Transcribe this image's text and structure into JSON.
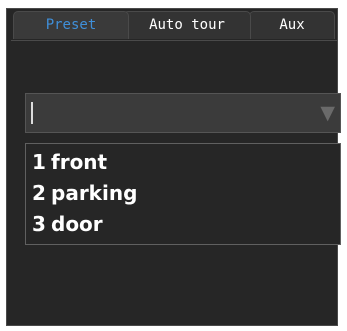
{
  "tabs": [
    {
      "label": "Preset",
      "active": true
    },
    {
      "label": "Auto tour",
      "active": false
    },
    {
      "label": "Aux",
      "active": false
    }
  ],
  "preset_select": {
    "value": "",
    "arrow_icon": "triangle-down-icon"
  },
  "presets": [
    {
      "number": "1",
      "name": "front"
    },
    {
      "number": "2",
      "name": "parking"
    },
    {
      "number": "3",
      "name": "door"
    }
  ],
  "colors": {
    "panel_bg": "#262626",
    "active_tab_text": "#3f8fd9",
    "text": "#ffffff"
  }
}
